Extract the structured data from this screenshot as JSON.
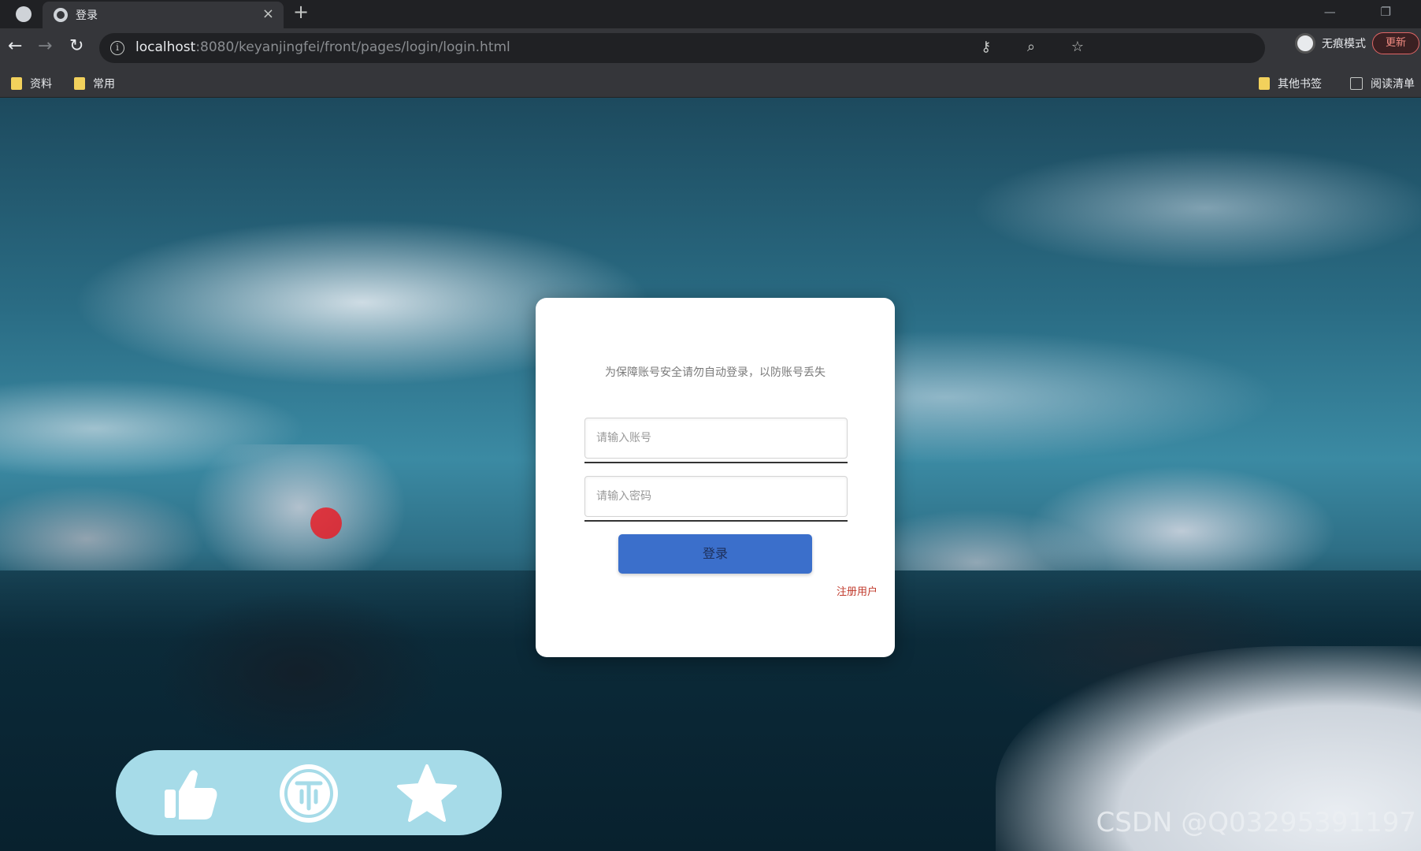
{
  "tab": {
    "title": "登录",
    "close": "×",
    "new_tab": "+"
  },
  "window": {
    "controls": "— ❐"
  },
  "toolbar": {
    "back": "←",
    "forward": "→",
    "reload": "↻",
    "info": "i",
    "url_host": "localhost",
    "url_rest": ":8080/keyanjingfei/front/pages/login/login.html",
    "omni_icons": "⚷ ⌕ ☆",
    "profile_label": "无痕模式",
    "update_label": "更新"
  },
  "bookmarks": {
    "left": [
      {
        "label": "资料"
      },
      {
        "label": "常用"
      }
    ],
    "other": "其他书签",
    "reading_list": "阅读清单"
  },
  "login": {
    "hint": "为保障账号安全请勿自动登录，以防账号丢失",
    "account_placeholder": "请输入账号",
    "password_placeholder": "请输入密码",
    "login_button": "登录",
    "register_link": "注册用户"
  },
  "overlay": {
    "icons": [
      "thumbs-up-icon",
      "coin-icon",
      "star-icon"
    ],
    "accent": "#a6dbe8"
  },
  "watermark": "CSDN @Q03295391197"
}
